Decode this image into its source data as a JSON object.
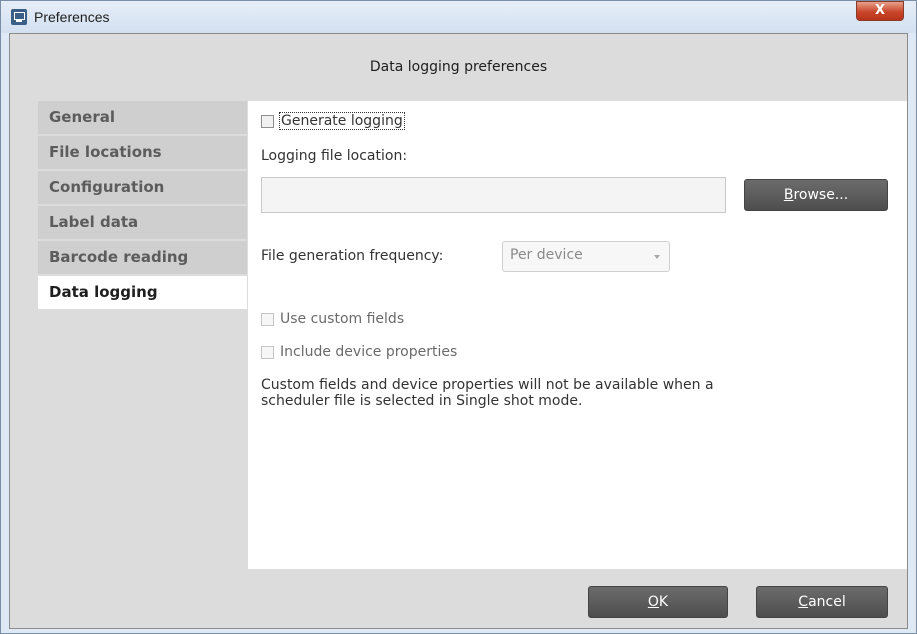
{
  "window": {
    "title": "Preferences",
    "close_glyph": "X"
  },
  "header": {
    "title": "Data logging preferences"
  },
  "nav": {
    "items": [
      {
        "label": "General",
        "active": false
      },
      {
        "label": "File locations",
        "active": false
      },
      {
        "label": "Configuration",
        "active": false
      },
      {
        "label": "Label data",
        "active": false
      },
      {
        "label": "Barcode reading",
        "active": false
      },
      {
        "label": "Data logging",
        "active": true
      }
    ]
  },
  "panel": {
    "generate_logging": {
      "label": "Generate logging",
      "checked": false
    },
    "file_location_label": "Logging file location:",
    "file_location_value": "",
    "browse": {
      "mnemonic": "B",
      "rest": "rowse..."
    },
    "frequency_label": "File generation frequency:",
    "frequency_value": "Per device",
    "use_custom_fields": {
      "label": "Use custom fields",
      "checked": false,
      "enabled": false
    },
    "include_device_properties": {
      "label": "Include device properties",
      "checked": false,
      "enabled": false
    },
    "note_line1": "Custom fields and device properties will not be available when a",
    "note_line2": "scheduler file is selected in Single shot mode."
  },
  "footer": {
    "ok": {
      "mnemonic": "O",
      "rest": "K"
    },
    "cancel": {
      "mnemonic": "C",
      "rest": "ancel"
    }
  },
  "icons": {
    "app": "app-icon",
    "close": "close-icon",
    "dropdown": "chevron-down-icon"
  },
  "colors": {
    "titlebar": "#dfe9f5",
    "close_button": "#c9452a",
    "button_dark": "#595959",
    "nav_active": "#ffffff"
  }
}
